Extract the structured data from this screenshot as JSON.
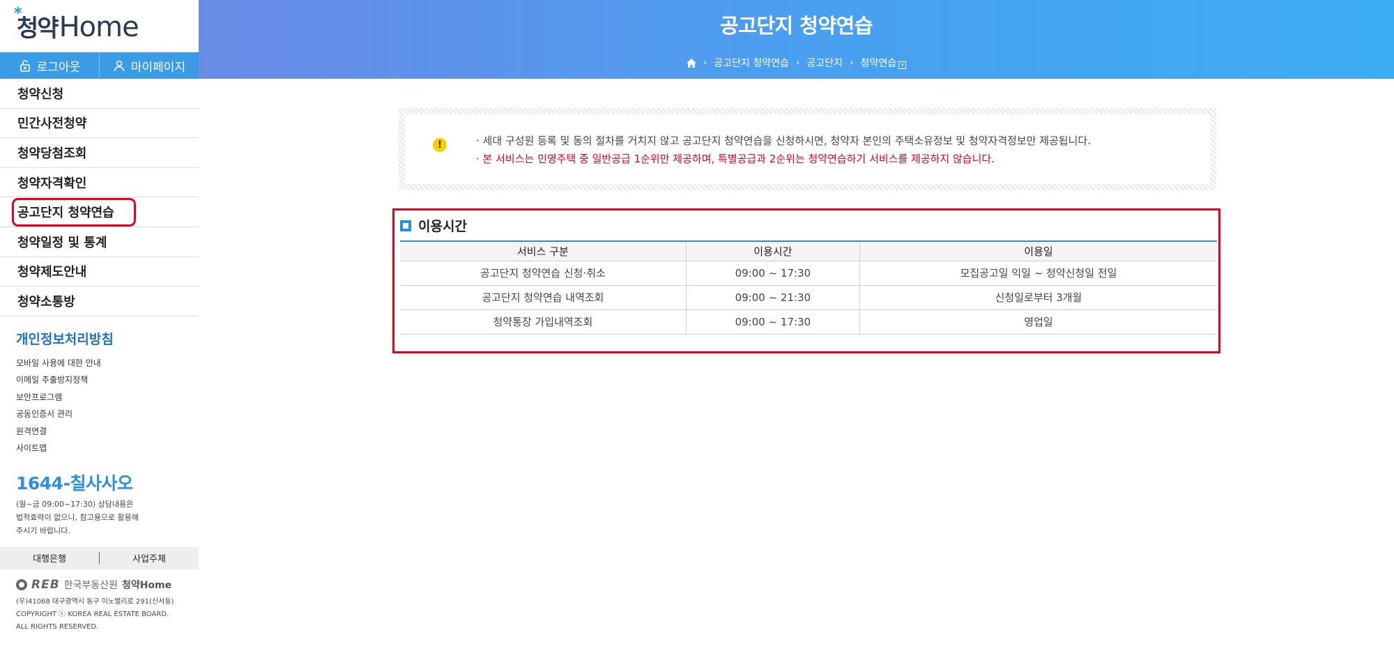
{
  "sidebar": {
    "logo": {
      "ko": "청약",
      "en": "Home",
      "star": "*"
    },
    "auth": {
      "logout": "로그아웃",
      "mypage": "마이페이지"
    },
    "menu": [
      "청약신청",
      "민간사전청약",
      "청약당첨조회",
      "청약자격확인",
      "공고단지 청약연습",
      "청약일정 및 통계",
      "청약제도안내",
      "청약소통방"
    ],
    "policy_title": "개인정보처리방침",
    "policy_links": [
      "모바일 사용에 대한 안내",
      "이메일 추출방지정책",
      "보안프로그램",
      "공동인증서 관리",
      "원격연결",
      "사이트맵"
    ],
    "hotline": {
      "tel": "1644-칠사사오",
      "desc1": "(월~금 09:00~17:30) 상담내용은",
      "desc2": "법적효력이 없으니, 참고용으로 활용해",
      "desc3": "주시기 바랍니다."
    },
    "bank_bar": {
      "bank": "대행은행",
      "biz": "사업주체"
    },
    "footer": {
      "reb": "REB",
      "org": "한국부동산원",
      "brand": "청약Home",
      "addr": "(우)41068 대구광역시 동구 이노밸리로 291(신서동)",
      "copy1": "COPYRIGHT ⓒ KOREA REAL ESTATE BOARD.",
      "copy2": "ALL RIGHTS RESERVED."
    }
  },
  "header": {
    "title": "공고단지 청약연습",
    "breadcrumb": [
      "공고단지 청약연습",
      "공고단지",
      "청약연습"
    ]
  },
  "notice": {
    "line1": "· 세대 구성원 등록 및 동의 절차를 거치지 않고 공고단지 청약연습을 신청하시면, 청약자 본인의 주택소유정보 및 청약자격정보만 제공됩니다.",
    "line2": "· 본 서비스는 민영주택 중 일반공급 1순위만 제공하며, 특별공급과 2순위는 청약연습하기 서비스를 제공하지 않습니다."
  },
  "usage": {
    "title": "이용시간",
    "columns": [
      "서비스 구분",
      "이용시간",
      "이용일"
    ],
    "rows": [
      [
        "공고단지 청약연습 신청·취소",
        "09:00 ~ 17:30",
        "모집공고일 익일 ~ 청약신청일 전일"
      ],
      [
        "공고단지 청약연습 내역조회",
        "09:00 ~ 21:30",
        "신청일로부터 3개월"
      ],
      [
        "청약통장 가입내역조회",
        "09:00 ~ 17:30",
        "영업일"
      ]
    ]
  },
  "colors": {
    "accent": "#3a9be6",
    "highlight": "#e6001e",
    "link_blue": "#1a73c9"
  }
}
